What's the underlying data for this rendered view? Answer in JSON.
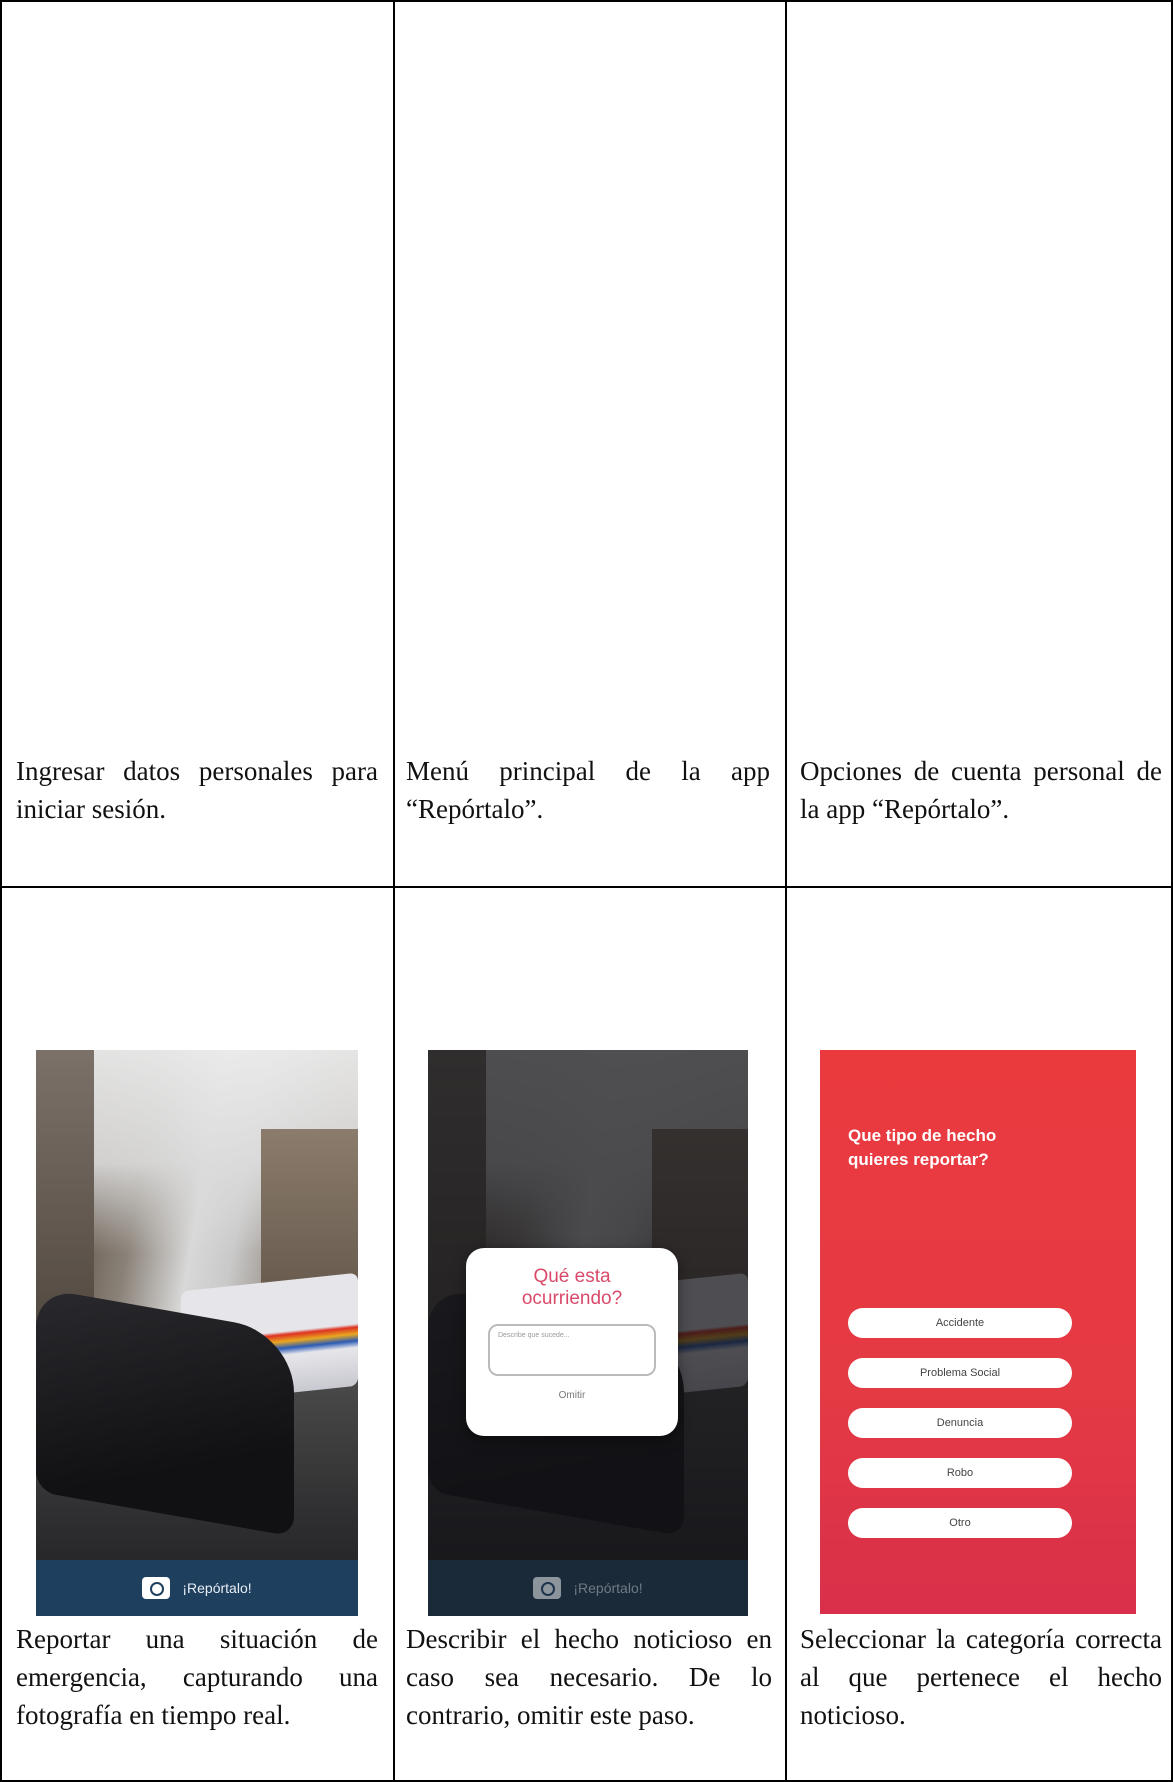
{
  "captions": {
    "row1": [
      "Ingresar datos personales para iniciar sesión.",
      "Menú principal de la app “Repórtalo”.",
      "Opciones de cuenta personal de la app “Repórtalo”."
    ],
    "row2": [
      "Reportar una situación de emergencia, capturando una fotografía en tiempo real.",
      "Describir el hecho noticioso en caso sea necesario. De lo contrario, omitir este paso.",
      "Seleccionar la categoría correcta al que pertenece el hecho noticioso."
    ]
  },
  "screen_camera": {
    "button_label": "¡Repórtalo!"
  },
  "screen_dialog": {
    "title": "Qué esta ocurriendo?",
    "input_placeholder": "Describe que sucede...",
    "skip_label": "Omitir",
    "button_label": "¡Repórtalo!"
  },
  "screen_category": {
    "question": "Que tipo de hecho quieres reportar?",
    "options": [
      "Accidente",
      "Problema Social",
      "Denuncia",
      "Robo",
      "Otro"
    ]
  },
  "colors": {
    "accent_red": "#e43a44",
    "dialog_title": "#d94a6a",
    "bar_blue": "#1f3f5e"
  }
}
